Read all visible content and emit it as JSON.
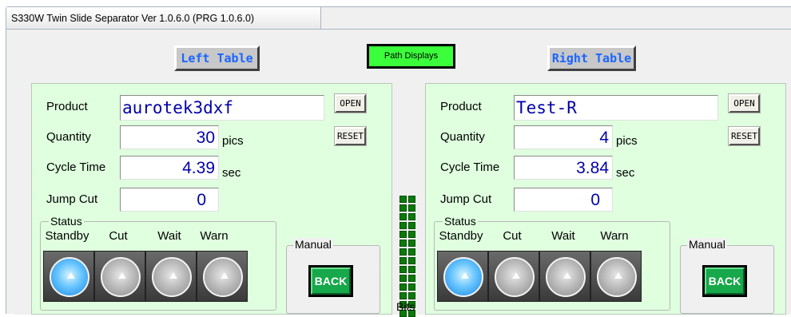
{
  "window": {
    "title": "S330W Twin Slide Separator  Ver 1.0.6.0 (PRG 1.0.6.0)"
  },
  "path_displays": "Path Displays",
  "bits_label": "Bits",
  "left": {
    "title": "Left Table",
    "product_label": "Product",
    "product_value": "aurotek3dxf",
    "quantity_label": "Quantity",
    "quantity_value": "30",
    "quantity_unit": "pics",
    "cycle_label": "Cycle Time",
    "cycle_value": "4.39",
    "cycle_unit": "sec",
    "jump_label": "Jump Cut",
    "jump_value": "0",
    "open_label": "OPEN",
    "reset_label": "RESET",
    "status_label": "Status",
    "status_cols": [
      "Standby",
      "Cut",
      "Wait",
      "Warn"
    ],
    "status_active": "Standby",
    "manual_label": "Manual",
    "back_label": "BACK"
  },
  "right": {
    "title": "Right Table",
    "product_label": "Product",
    "product_value": "Test-R",
    "quantity_label": "Quantity",
    "quantity_value": "4",
    "quantity_unit": "pics",
    "cycle_label": "Cycle Time",
    "cycle_value": "3.84",
    "cycle_unit": "sec",
    "jump_label": "Jump Cut",
    "jump_value": "0",
    "open_label": "OPEN",
    "reset_label": "RESET",
    "status_label": "Status",
    "status_cols": [
      "Standby",
      "Cut",
      "Wait",
      "Warn"
    ],
    "status_active": "Standby",
    "manual_label": "Manual",
    "back_label": "BACK"
  },
  "colors": {
    "panel_bg": "#dfffdf",
    "value_text": "#0000a8",
    "title_text": "#1a66ff",
    "path_btn": "#3bff3b",
    "back_btn": "#16a84a",
    "lamp_on": "#66c4ff",
    "bit_led": "#0a7a0a"
  }
}
